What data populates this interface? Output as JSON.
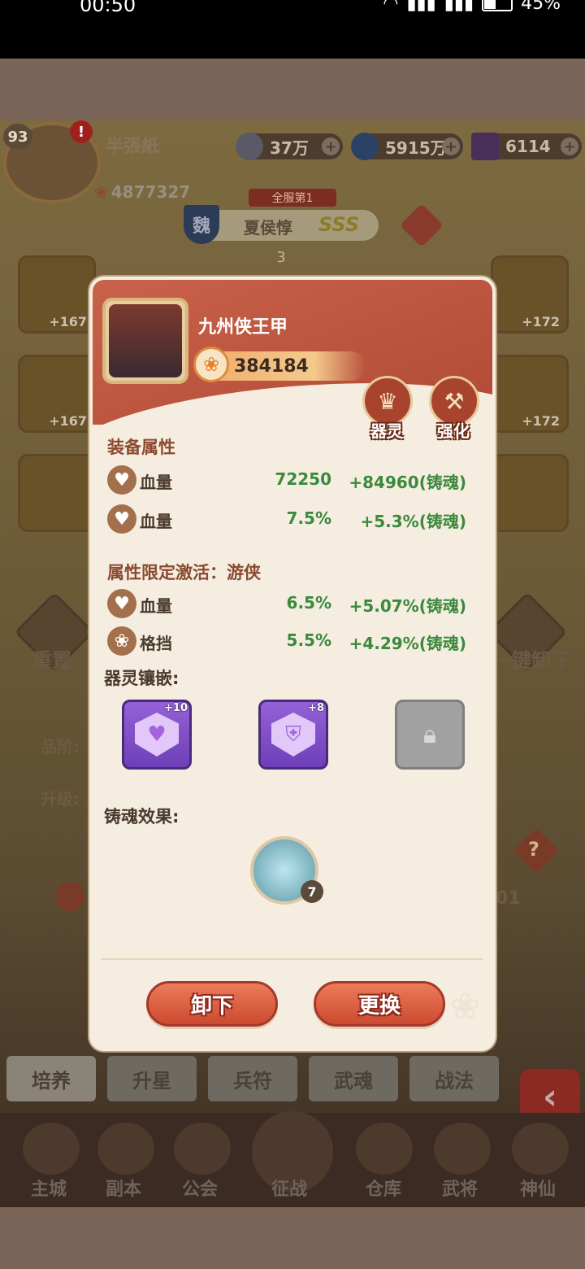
{
  "status_bar": {
    "time": "00:50",
    "battery": "45%"
  },
  "player": {
    "level": "93",
    "name": "半張紙",
    "power": "4877327"
  },
  "resources": [
    {
      "value": "37万"
    },
    {
      "value": "5915万"
    },
    {
      "value": "6114"
    }
  ],
  "hero": {
    "rank": "全服第1",
    "faction": "魏",
    "name": "夏侯惇",
    "grade": "SSS",
    "stars": "3"
  },
  "slots": {
    "left_top": "+167",
    "left_mid": "+167",
    "right_top": "+172",
    "right_mid": "+172"
  },
  "side_buttons": {
    "reset": "重置",
    "unequip_all": "一键卸下"
  },
  "labels": {
    "quality": "品阶:",
    "upgrade": "升级:",
    "help": "?",
    "partial": "01"
  },
  "tabs": [
    "培养",
    "升星",
    "兵符",
    "武魂",
    "战法"
  ],
  "bottom_nav": [
    "主城",
    "副本",
    "公会",
    "征战",
    "仓库",
    "武将",
    "神仙"
  ],
  "dialog": {
    "item_name": "九州侠王甲",
    "score": "384184",
    "btn_spirit": "器灵",
    "btn_enhance": "强化",
    "section_attr": "装备属性",
    "attrs": [
      {
        "name": "血量",
        "value": "72250",
        "bonus": "+84960(铸魂)"
      },
      {
        "name": "血量",
        "value": "7.5%",
        "bonus": "+5.3%(铸魂)"
      }
    ],
    "section_limit": "属性限定激活：游侠",
    "limit_attrs": [
      {
        "name": "血量",
        "value": "6.5%",
        "bonus": "+5.07%(铸魂)"
      },
      {
        "name": "格挡",
        "value": "5.5%",
        "bonus": "+4.29%(铸魂)"
      }
    ],
    "section_inlay": "器灵镶嵌:",
    "gems": [
      {
        "plus": "+10"
      },
      {
        "plus": "+8"
      }
    ],
    "section_effect": "铸魂效果:",
    "effect_count": "7",
    "btn_unequip": "卸下",
    "btn_replace": "更换"
  }
}
